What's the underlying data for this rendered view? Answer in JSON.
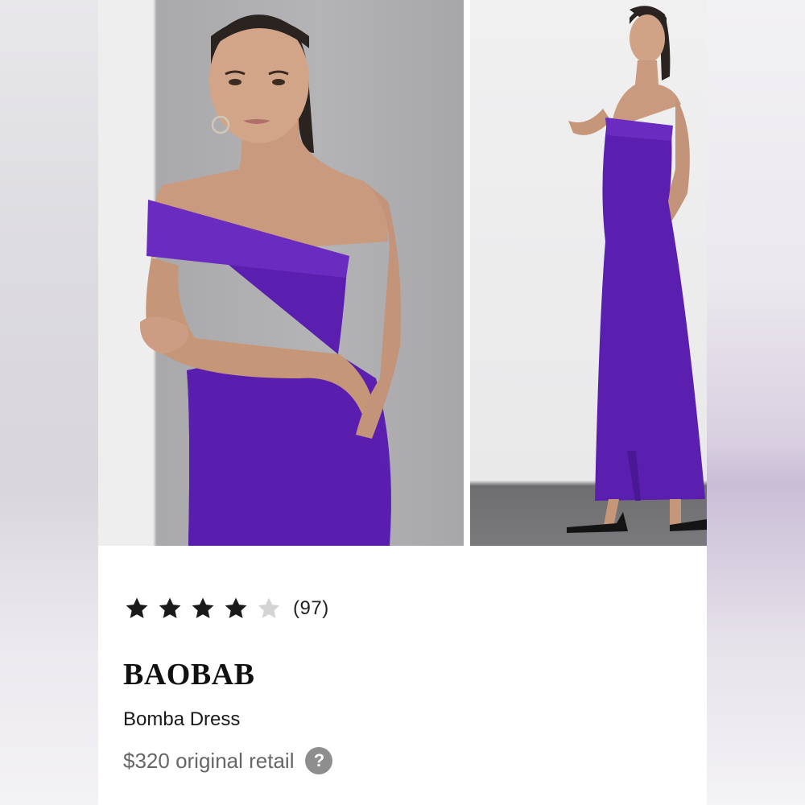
{
  "listing": {
    "rating": {
      "value": 4,
      "max": 5,
      "count_label": "(97)"
    },
    "brand": "BAOBAB",
    "product_name": "Bomba Dress",
    "price_label": "$320 original retail",
    "help_icon_glyph": "?"
  },
  "colors": {
    "dress": "#5b1fb0",
    "star_filled": "#1a1a1a",
    "star_empty": "#d4d4d4",
    "help_badge": "#8e8e8e"
  },
  "icons": [
    "star-icon",
    "help-icon"
  ]
}
